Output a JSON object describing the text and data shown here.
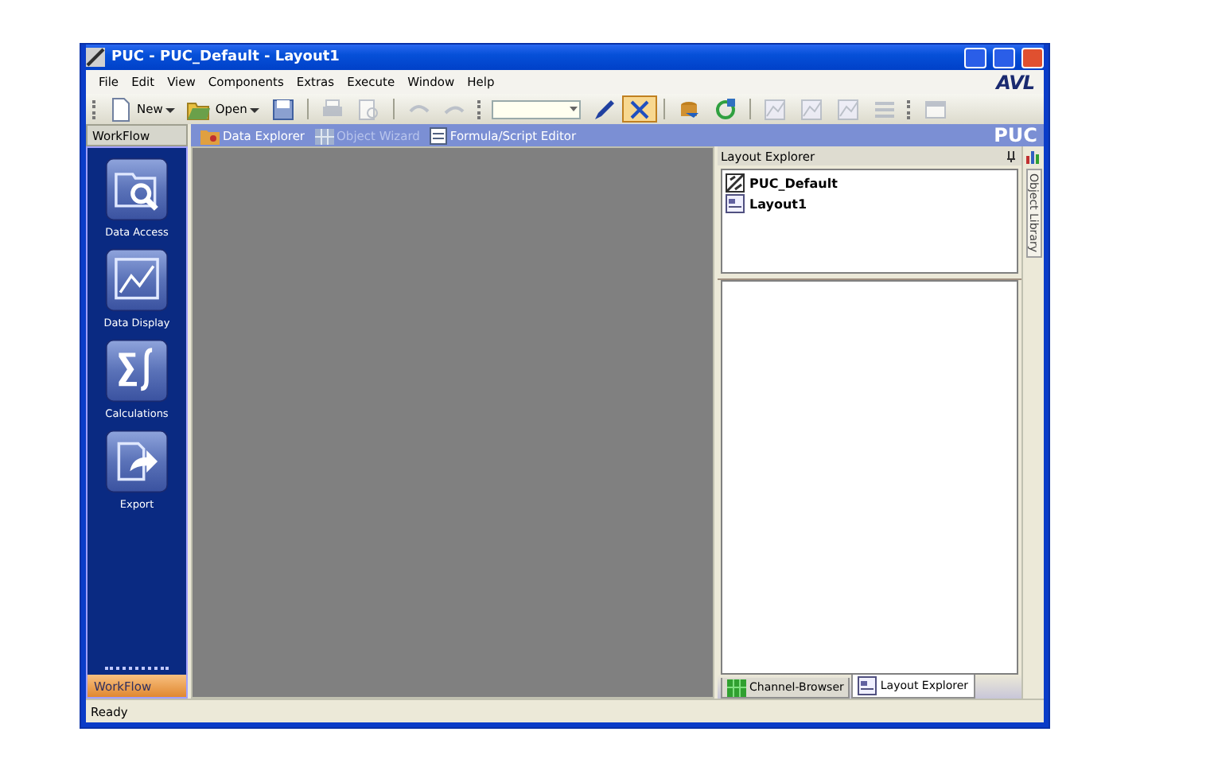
{
  "window": {
    "title": "PUC - PUC_Default - Layout1"
  },
  "menu": [
    "File",
    "Edit",
    "View",
    "Components",
    "Extras",
    "Execute",
    "Window",
    "Help"
  ],
  "logo": "AVL",
  "toolbar": [
    {
      "kind": "grip"
    },
    {
      "kind": "new",
      "label": "New",
      "dropdown": true
    },
    {
      "kind": "open",
      "label": "Open",
      "dropdown": true
    },
    {
      "kind": "save"
    },
    {
      "kind": "sep"
    },
    {
      "kind": "print",
      "disabled": true
    },
    {
      "kind": "preview",
      "disabled": true
    },
    {
      "kind": "sep"
    },
    {
      "kind": "undo",
      "disabled": true
    },
    {
      "kind": "redo",
      "disabled": true
    },
    {
      "kind": "grip"
    },
    {
      "kind": "combo"
    },
    {
      "kind": "pen"
    },
    {
      "kind": "cross",
      "pressed": true
    },
    {
      "kind": "sep"
    },
    {
      "kind": "db"
    },
    {
      "kind": "refresh"
    },
    {
      "kind": "sep"
    },
    {
      "kind": "chart",
      "disabled": true
    },
    {
      "kind": "chart",
      "disabled": true
    },
    {
      "kind": "chart",
      "disabled": true
    },
    {
      "kind": "bars",
      "disabled": true
    },
    {
      "kind": "grip"
    },
    {
      "kind": "window",
      "disabled": true
    }
  ],
  "workflow": {
    "title": "WorkFlow",
    "items": [
      {
        "kind": "access",
        "label": "Data Access"
      },
      {
        "kind": "display",
        "label": "Data Display"
      },
      {
        "kind": "calc",
        "label": "Calculations"
      },
      {
        "kind": "export",
        "label": "Export"
      }
    ],
    "footer": "WorkFlow"
  },
  "doc_tabs": [
    {
      "kind": "explorer",
      "label": "Data Explorer",
      "disabled": false
    },
    {
      "kind": "wizard",
      "label": "Object Wizard",
      "disabled": true
    },
    {
      "kind": "formula",
      "label": "Formula/Script Editor",
      "disabled": false
    }
  ],
  "app_name": "PUC",
  "layout_explorer": {
    "title": "Layout Explorer",
    "items": [
      {
        "kind": "default",
        "label": "PUC_Default"
      },
      {
        "kind": "layout",
        "label": "Layout1"
      }
    ]
  },
  "panel_tabs": [
    {
      "kind": "channel",
      "label": "Channel-Browser",
      "selected": false
    },
    {
      "kind": "layout",
      "label": "Layout Explorer",
      "selected": true
    }
  ],
  "side_tab": "Object Library",
  "status_bar": "Ready"
}
